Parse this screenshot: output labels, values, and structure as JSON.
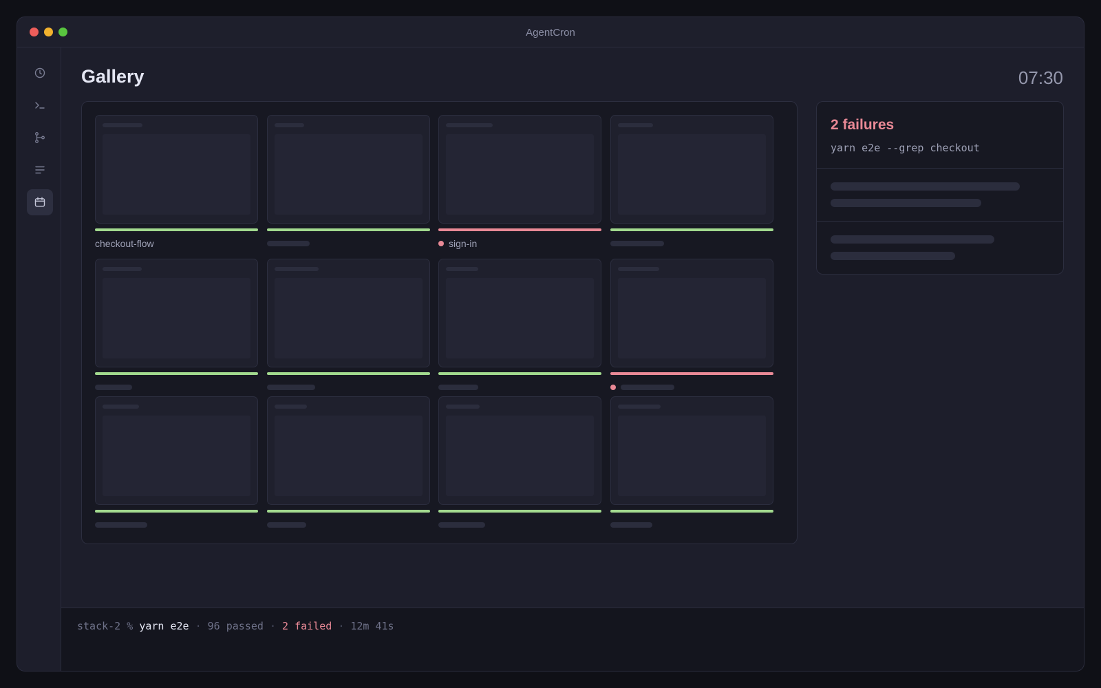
{
  "app": {
    "title": "AgentCron"
  },
  "colors": {
    "pass": "#a2d98e",
    "fail": "#e98996",
    "accent_text": "#e4e6f3"
  },
  "sidebar": {
    "items": [
      {
        "icon": "clock-icon",
        "active": false
      },
      {
        "icon": "terminal-icon",
        "active": false
      },
      {
        "icon": "git-branch-icon",
        "active": false
      },
      {
        "icon": "list-icon",
        "active": false
      },
      {
        "icon": "calendar-icon",
        "active": true
      }
    ]
  },
  "header": {
    "title": "Gallery",
    "clock": "07:30"
  },
  "gallery": {
    "cards": [
      {
        "status": "pass",
        "label": "checkout-flow"
      },
      {
        "status": "pass",
        "label": ""
      },
      {
        "status": "fail",
        "label": "sign-in"
      },
      {
        "status": "pass",
        "label": ""
      },
      {
        "status": "pass",
        "label": ""
      },
      {
        "status": "pass",
        "label": ""
      },
      {
        "status": "pass",
        "label": ""
      },
      {
        "status": "fail",
        "label": ""
      },
      {
        "status": "pass",
        "label": ""
      },
      {
        "status": "pass",
        "label": ""
      },
      {
        "status": "pass",
        "label": ""
      },
      {
        "status": "pass",
        "label": ""
      }
    ]
  },
  "failures": {
    "title": "2 failures",
    "command": "yarn e2e --grep checkout"
  },
  "terminal": {
    "prompt": "stack-2 %",
    "command": "yarn e2e",
    "sep": "·",
    "passed": "96 passed",
    "failed": "2 failed",
    "duration": "12m 41s"
  }
}
